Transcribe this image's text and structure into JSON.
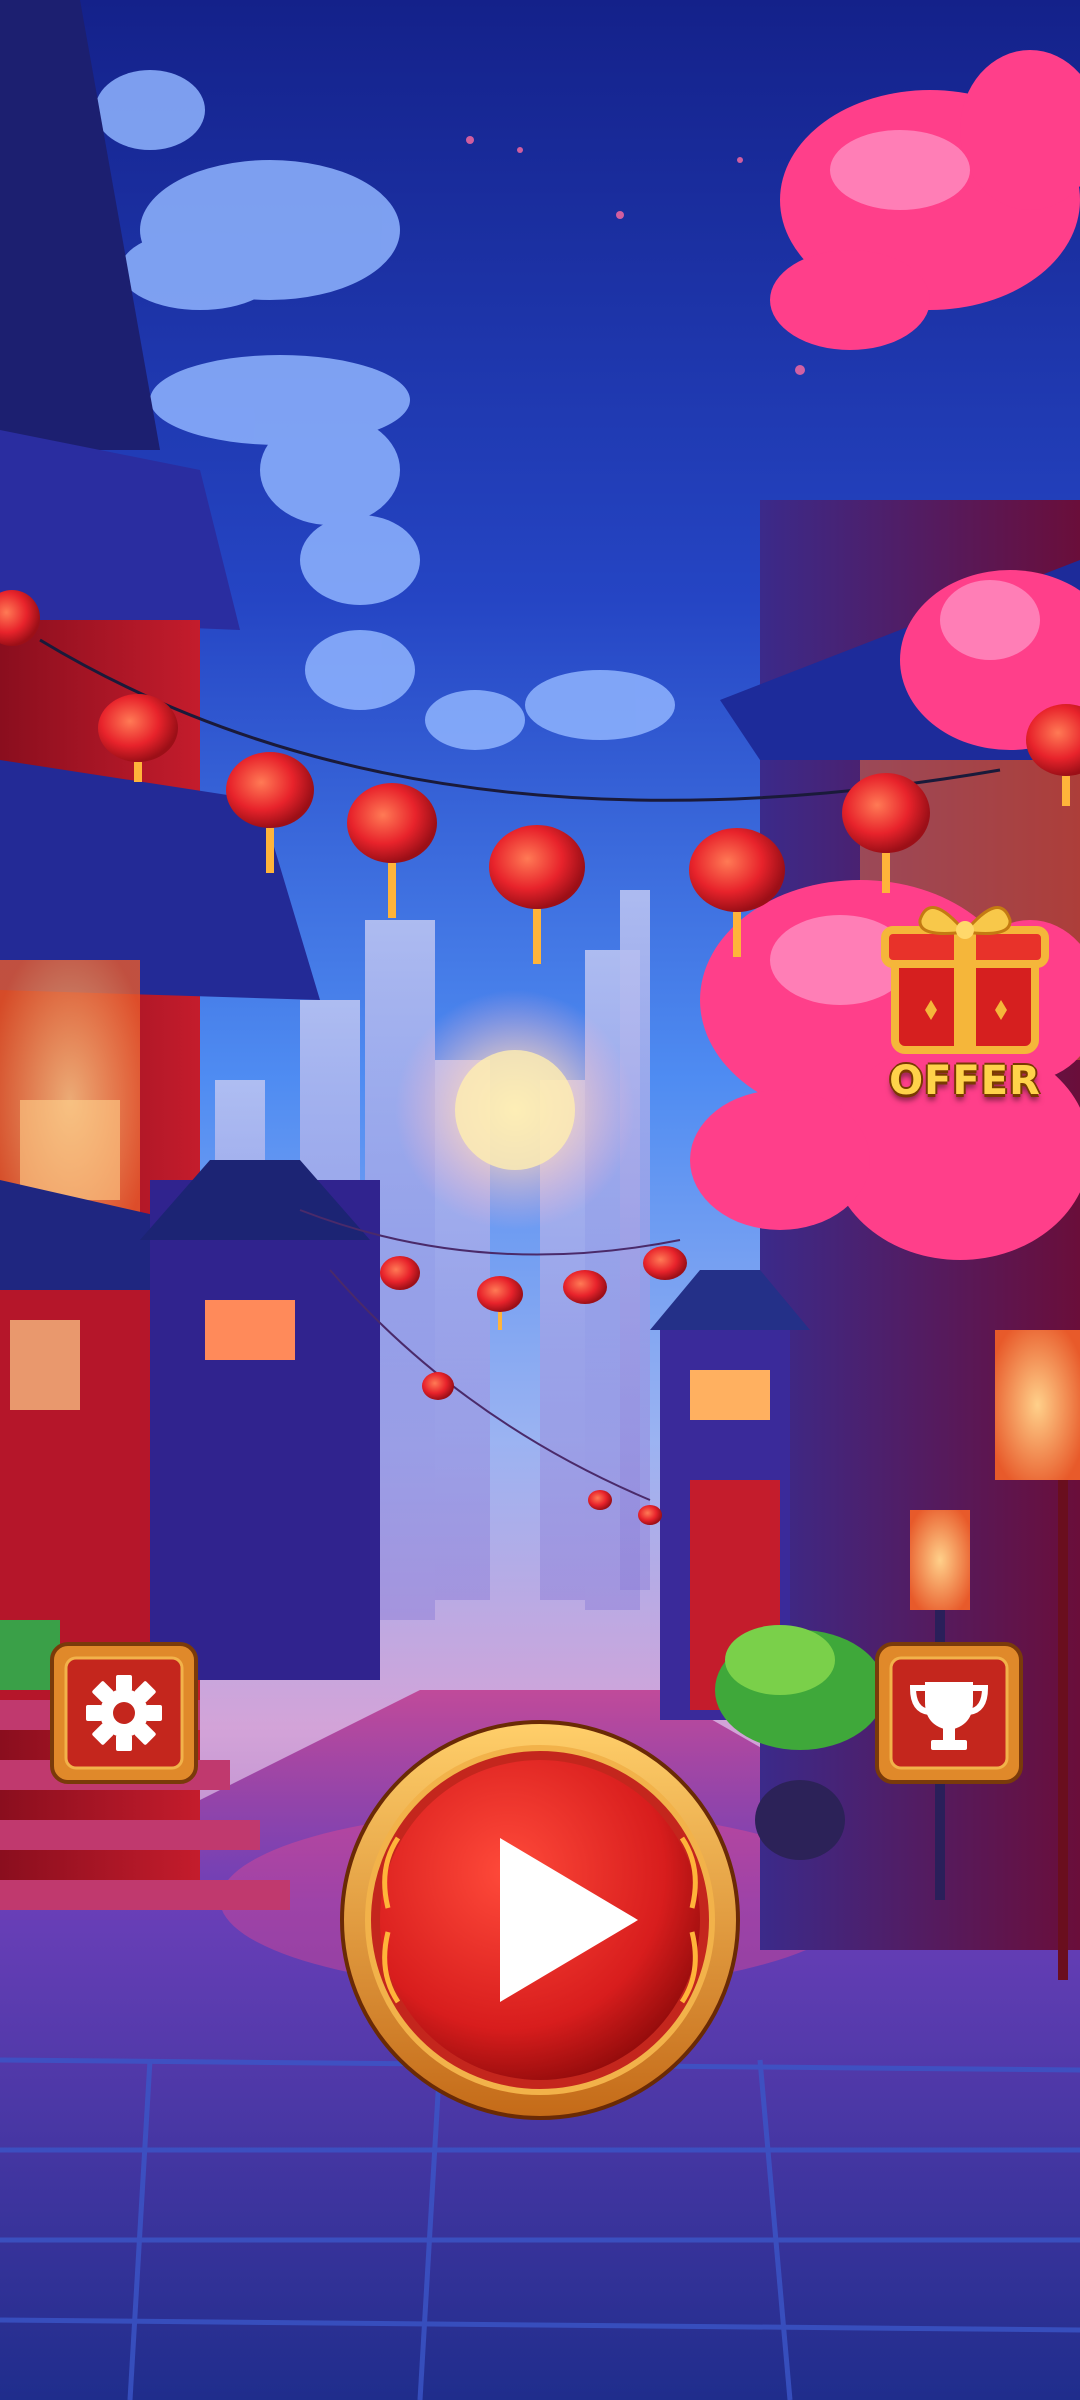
{
  "hud": {
    "offer_label": "OFFER",
    "icons": {
      "settings": "gear-icon",
      "leaderboard": "trophy-icon",
      "play": "play-icon",
      "offer": "gift-box-icon"
    }
  },
  "colors": {
    "sky_top": "#1c2d9c",
    "sky_mid": "#3f7ef0",
    "lantern_red": "#e8232b",
    "blossom_pink": "#ff3f8a",
    "gold_frame": "#e0892a",
    "play_red": "#d81d1d",
    "street_blue": "#2c3fa8"
  }
}
